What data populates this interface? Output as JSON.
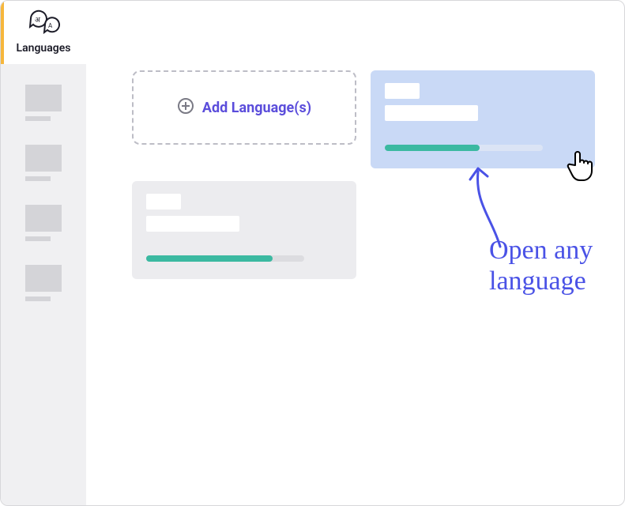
{
  "sidebar": {
    "active_tab_label": "Languages"
  },
  "add_card": {
    "label": "Add Language(s)"
  },
  "cards": {
    "a_progress_pct": 60,
    "b_progress_pct": 80
  },
  "annotation": {
    "text": "Open any language"
  }
}
